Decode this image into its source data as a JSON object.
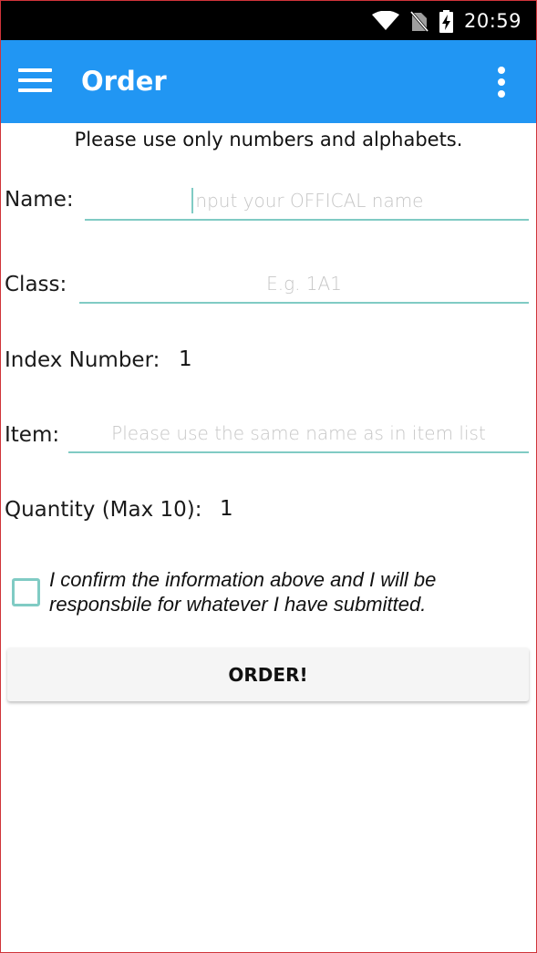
{
  "status_bar": {
    "time": "20:59",
    "icons": [
      "wifi-icon",
      "no-sim-icon",
      "battery-charging-icon"
    ]
  },
  "app_bar": {
    "title": "Order",
    "menu_icon": "hamburger-menu-icon",
    "overflow_icon": "more-vert-icon",
    "color": "#2196f3"
  },
  "form": {
    "note": "Please use only numbers and alphabets.",
    "name": {
      "label": "Name:",
      "value": "",
      "placeholder": "Input your OFFICAL name"
    },
    "class": {
      "label": "Class:",
      "value": "",
      "placeholder": "E.g. 1A1"
    },
    "index_number": {
      "label": "Index Number:",
      "value": "1"
    },
    "item": {
      "label": "Item:",
      "value": "",
      "placeholder": "Please use the same name as in item list"
    },
    "quantity": {
      "label": "Quantity (Max 10):",
      "value": "1"
    },
    "confirm": {
      "checked": false,
      "text": "I confirm the information above and I will be responsbile for whatever I have submitted."
    },
    "submit_label": "ORDER!"
  },
  "colors": {
    "accent": "#80cbc4",
    "status_bar": "#000000"
  }
}
